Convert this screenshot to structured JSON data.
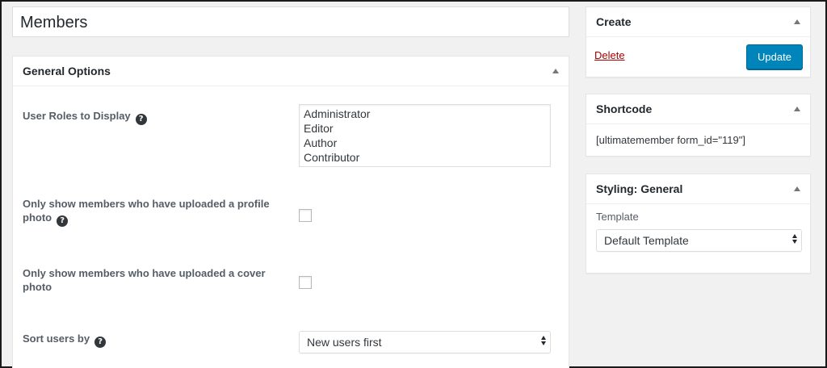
{
  "post_title": "Members",
  "general_options": {
    "title": "General Options",
    "user_roles_label": "User Roles to Display",
    "roles": [
      "Administrator",
      "Editor",
      "Author",
      "Contributor"
    ],
    "profile_photo_label": "Only show members who have uploaded a profile photo",
    "cover_photo_label": "Only show members who have uploaded a cover photo",
    "sort_label": "Sort users by",
    "sort_value": "New users first"
  },
  "create_box": {
    "title": "Create",
    "delete_label": "Delete",
    "update_label": "Update"
  },
  "shortcode_box": {
    "title": "Shortcode",
    "code": "[ultimatemember form_id=\"119\"]"
  },
  "styling_box": {
    "title": "Styling: General",
    "template_label": "Template",
    "template_value": "Default Template"
  },
  "icons": {
    "help": "help-icon",
    "toggle": "toggle-arrow-icon"
  },
  "colors": {
    "primary_button": "#0085ba",
    "delete_link": "#a00000"
  }
}
